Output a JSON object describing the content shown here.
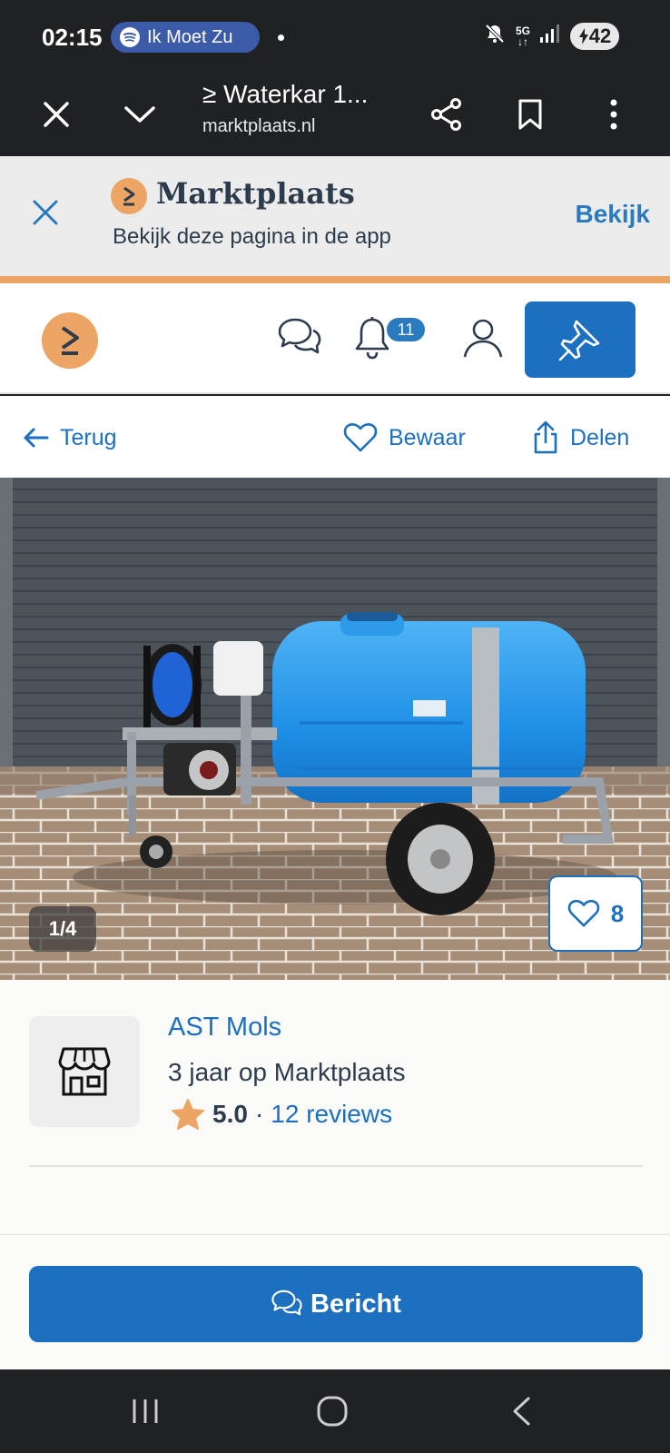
{
  "status_bar": {
    "time": "02:15",
    "media_app_icon": "spotify-icon",
    "media_text": "Ik Moet Zu",
    "network": "5G",
    "battery": "42"
  },
  "browser": {
    "title": "≥ Waterkar 1...",
    "url": "marktplaats.nl"
  },
  "app_banner": {
    "brand": "Marktplaats",
    "subtitle": "Bekijk deze pagina in de app",
    "open_label": "Bekijk"
  },
  "header": {
    "notification_count": "11"
  },
  "actions": {
    "back": "Terug",
    "save": "Bewaar",
    "share": "Delen"
  },
  "photo": {
    "counter": "1/4",
    "favorites": "8"
  },
  "seller": {
    "name": "AST Mols",
    "since": "3 jaar op Marktplaats",
    "rating": "5.0",
    "separator": "·",
    "reviews": "12 reviews"
  },
  "cta": {
    "label": "Bericht"
  },
  "colors": {
    "brand_blue": "#1d6fc0",
    "brand_orange": "#eda565",
    "dark": "#202124"
  }
}
